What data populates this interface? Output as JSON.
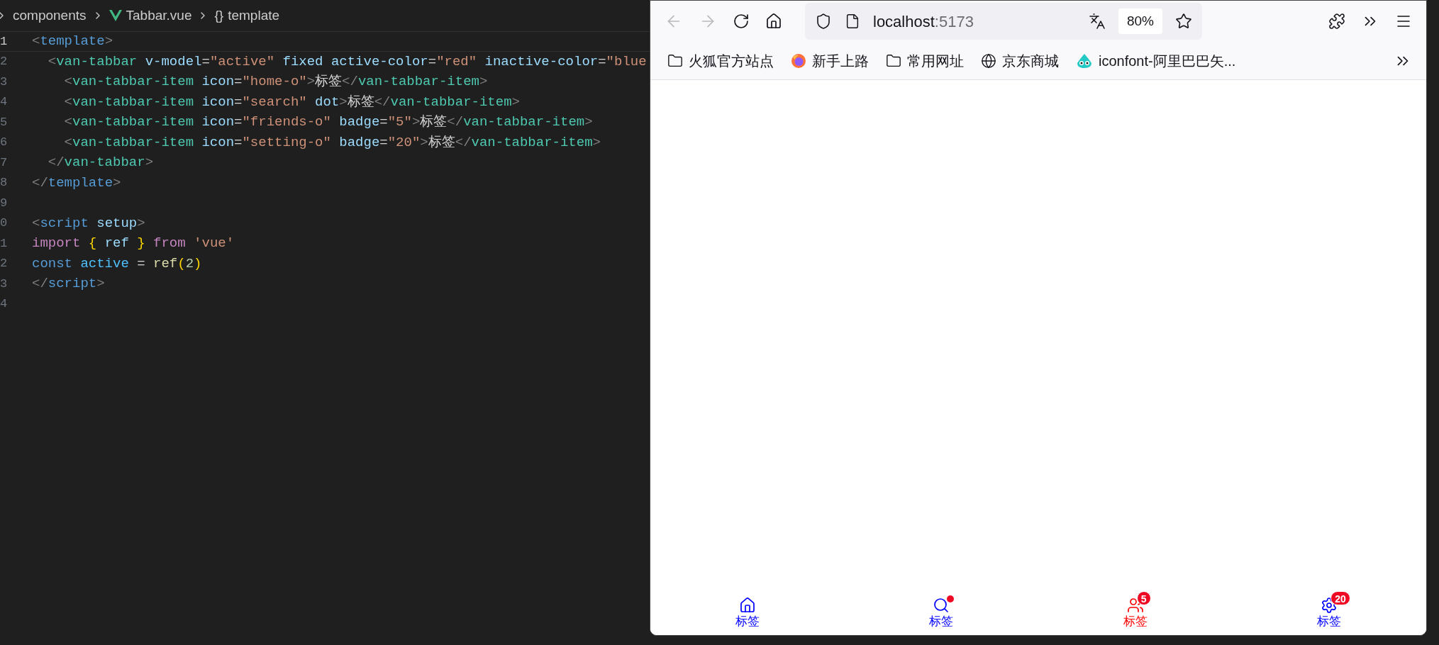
{
  "editor": {
    "breadcrumb": [
      {
        "kind": "folder",
        "text": "components"
      },
      {
        "kind": "vue",
        "text": "Tabbar.vue"
      },
      {
        "kind": "symbol",
        "icon": "{}",
        "text": "template"
      }
    ],
    "lines": [
      {
        "number": "1",
        "current": true,
        "tokens": [
          {
            "kind": "punct",
            "text": "<"
          },
          {
            "kind": "tag",
            "text": "template"
          },
          {
            "kind": "punct",
            "text": ">"
          }
        ]
      },
      {
        "number": "2",
        "current": false,
        "tokens": [
          {
            "kind": "punct",
            "text": "  <"
          },
          {
            "kind": "component",
            "text": "van-tabbar"
          },
          {
            "kind": "attr",
            "text": " v-model"
          },
          {
            "kind": "plain",
            "text": "="
          },
          {
            "kind": "string",
            "text": "\"active\""
          },
          {
            "kind": "attr",
            "text": " fixed active-color"
          },
          {
            "kind": "plain",
            "text": "="
          },
          {
            "kind": "string",
            "text": "\"red\""
          },
          {
            "kind": "attr",
            "text": " inactive-color"
          },
          {
            "kind": "plain",
            "text": "="
          },
          {
            "kind": "string",
            "text": "\"blue"
          }
        ]
      },
      {
        "number": "3",
        "current": false,
        "tokens": [
          {
            "kind": "punct",
            "text": "    <"
          },
          {
            "kind": "component",
            "text": "van-tabbar-item"
          },
          {
            "kind": "attr",
            "text": " icon"
          },
          {
            "kind": "plain",
            "text": "="
          },
          {
            "kind": "string",
            "text": "\"home-o\""
          },
          {
            "kind": "punct",
            "text": ">"
          },
          {
            "kind": "plain",
            "text": "标签"
          },
          {
            "kind": "punct",
            "text": "</"
          },
          {
            "kind": "component",
            "text": "van-tabbar-item"
          },
          {
            "kind": "punct",
            "text": ">"
          }
        ]
      },
      {
        "number": "4",
        "current": false,
        "tokens": [
          {
            "kind": "punct",
            "text": "    <"
          },
          {
            "kind": "component",
            "text": "van-tabbar-item"
          },
          {
            "kind": "attr",
            "text": " icon"
          },
          {
            "kind": "plain",
            "text": "="
          },
          {
            "kind": "string",
            "text": "\"search\""
          },
          {
            "kind": "attr",
            "text": " dot"
          },
          {
            "kind": "punct",
            "text": ">"
          },
          {
            "kind": "plain",
            "text": "标签"
          },
          {
            "kind": "punct",
            "text": "</"
          },
          {
            "kind": "component",
            "text": "van-tabbar-item"
          },
          {
            "kind": "punct",
            "text": ">"
          }
        ]
      },
      {
        "number": "5",
        "current": false,
        "tokens": [
          {
            "kind": "punct",
            "text": "    <"
          },
          {
            "kind": "component",
            "text": "van-tabbar-item"
          },
          {
            "kind": "attr",
            "text": " icon"
          },
          {
            "kind": "plain",
            "text": "="
          },
          {
            "kind": "string",
            "text": "\"friends-o\""
          },
          {
            "kind": "attr",
            "text": " badge"
          },
          {
            "kind": "plain",
            "text": "="
          },
          {
            "kind": "string",
            "text": "\"5\""
          },
          {
            "kind": "punct",
            "text": ">"
          },
          {
            "kind": "plain",
            "text": "标签"
          },
          {
            "kind": "punct",
            "text": "</"
          },
          {
            "kind": "component",
            "text": "van-tabbar-item"
          },
          {
            "kind": "punct",
            "text": ">"
          }
        ]
      },
      {
        "number": "6",
        "current": false,
        "tokens": [
          {
            "kind": "punct",
            "text": "    <"
          },
          {
            "kind": "component",
            "text": "van-tabbar-item"
          },
          {
            "kind": "attr",
            "text": " icon"
          },
          {
            "kind": "plain",
            "text": "="
          },
          {
            "kind": "string",
            "text": "\"setting-o\""
          },
          {
            "kind": "attr",
            "text": " badge"
          },
          {
            "kind": "plain",
            "text": "="
          },
          {
            "kind": "string",
            "text": "\"20\""
          },
          {
            "kind": "punct",
            "text": ">"
          },
          {
            "kind": "plain",
            "text": "标签"
          },
          {
            "kind": "punct",
            "text": "</"
          },
          {
            "kind": "component",
            "text": "van-tabbar-item"
          },
          {
            "kind": "punct",
            "text": ">"
          }
        ]
      },
      {
        "number": "7",
        "current": false,
        "tokens": [
          {
            "kind": "punct",
            "text": "  </"
          },
          {
            "kind": "component",
            "text": "van-tabbar"
          },
          {
            "kind": "punct",
            "text": ">"
          }
        ]
      },
      {
        "number": "8",
        "current": false,
        "tokens": [
          {
            "kind": "punct",
            "text": "</"
          },
          {
            "kind": "tag",
            "text": "template"
          },
          {
            "kind": "punct",
            "text": ">"
          }
        ]
      },
      {
        "number": "9",
        "current": false
      },
      {
        "number": "0",
        "current": false,
        "tokens": [
          {
            "kind": "punct",
            "text": "<"
          },
          {
            "kind": "tag",
            "text": "script"
          },
          {
            "kind": "attr",
            "text": " setup"
          },
          {
            "kind": "punct",
            "text": ">"
          }
        ]
      },
      {
        "number": "1",
        "current": false,
        "tokens": [
          {
            "kind": "keyword",
            "text": "import"
          },
          {
            "kind": "brace",
            "text": " {"
          },
          {
            "kind": "variable",
            "text": " ref "
          },
          {
            "kind": "brace",
            "text": "}"
          },
          {
            "kind": "keyword",
            "text": " from"
          },
          {
            "kind": "string",
            "text": " 'vue'"
          }
        ]
      },
      {
        "number": "2",
        "current": false,
        "tokens": [
          {
            "kind": "storage",
            "text": "const"
          },
          {
            "kind": "constant",
            "text": " active"
          },
          {
            "kind": "plain",
            "text": " = "
          },
          {
            "kind": "function",
            "text": "ref"
          },
          {
            "kind": "brace",
            "text": "("
          },
          {
            "kind": "number",
            "text": "2"
          },
          {
            "kind": "brace",
            "text": ")"
          }
        ]
      },
      {
        "number": "3",
        "current": false,
        "tokens": [
          {
            "kind": "punct",
            "text": "</"
          },
          {
            "kind": "tag",
            "text": "script"
          },
          {
            "kind": "punct",
            "text": ">"
          }
        ]
      },
      {
        "number": "4",
        "current": false
      }
    ]
  },
  "browser": {
    "url": {
      "host": "localhost",
      "port": ":5173"
    },
    "zoom": "80%",
    "bookmarks": [
      {
        "kind": "folder",
        "text": "火狐官方站点"
      },
      {
        "kind": "firefox",
        "text": "新手上路"
      },
      {
        "kind": "folder",
        "text": "常用网址"
      },
      {
        "kind": "globe",
        "text": "京东商城"
      },
      {
        "kind": "iconfont",
        "text": "iconfont-阿里巴巴矢..."
      }
    ],
    "tabbar": [
      {
        "kind": "home",
        "label": "标签",
        "selected": false,
        "dot": false
      },
      {
        "kind": "search",
        "label": "标签",
        "selected": false,
        "dot": true
      },
      {
        "kind": "friends",
        "label": "标签",
        "selected": true,
        "dot": false,
        "badge": "5"
      },
      {
        "kind": "setting",
        "label": "标签",
        "selected": false,
        "dot": false,
        "badge": "20"
      }
    ]
  }
}
